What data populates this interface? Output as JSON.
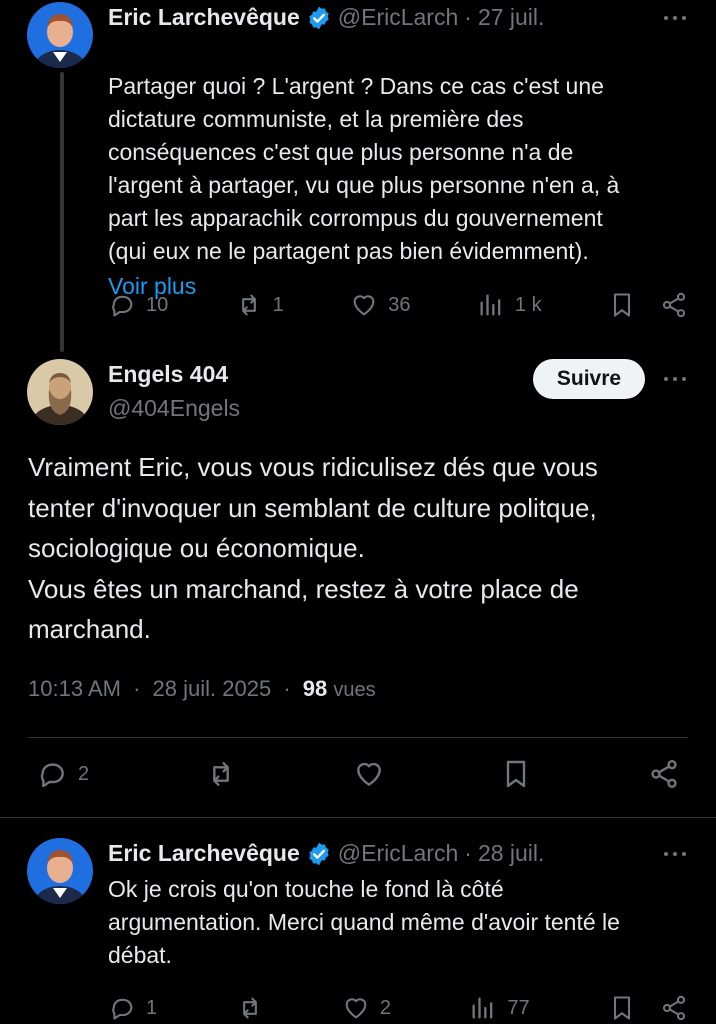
{
  "tweet1": {
    "name": "Eric Larchevêque",
    "handle": "@EricLarch",
    "date": "27 juil.",
    "text": "Partager quoi ? L'argent ? Dans ce cas c'est une\ndictature communiste, et la première des\nconséquences c'est que plus personne n'a de\nl'argent à partager, vu que plus personne n'en a, à\npart les apparachik corrompus du gouvernement\n(qui eux ne le partagent pas bien évidemment).",
    "show_more": "Voir plus",
    "replies": "10",
    "reposts": "1",
    "likes": "36",
    "views": "1 k"
  },
  "main_tweet": {
    "name": "Engels 404",
    "handle": "@404Engels",
    "follow_label": "Suivre",
    "text": "Vraiment Eric, vous vous ridiculisez dés que vous\ntenter d'invoquer un semblant de culture politque,\nsociologique ou économique.\nVous êtes un marchand, restez à votre place de\nmarchand.",
    "time": "10:13 AM",
    "date": "28 juil. 2025",
    "views_count": "98",
    "views_label": "vues",
    "replies": "2"
  },
  "tweet3": {
    "name": "Eric Larchevêque",
    "handle": "@EricLarch",
    "date": "28 juil.",
    "text": "Ok je crois qu'on touche le fond là côté\nargumentation. Merci quand même d'avoir tenté le\ndébat.",
    "replies": "1",
    "likes": "2",
    "views": "77"
  },
  "colors": {
    "background": "#000000",
    "text": "#e7e9ea",
    "muted": "#71767b",
    "link": "#1d9bf0",
    "verified": "#1d9bf0"
  },
  "icons": [
    "verified-badge-icon",
    "more-icon",
    "reply-icon",
    "repost-icon",
    "like-icon",
    "views-icon",
    "bookmark-icon",
    "share-icon"
  ]
}
